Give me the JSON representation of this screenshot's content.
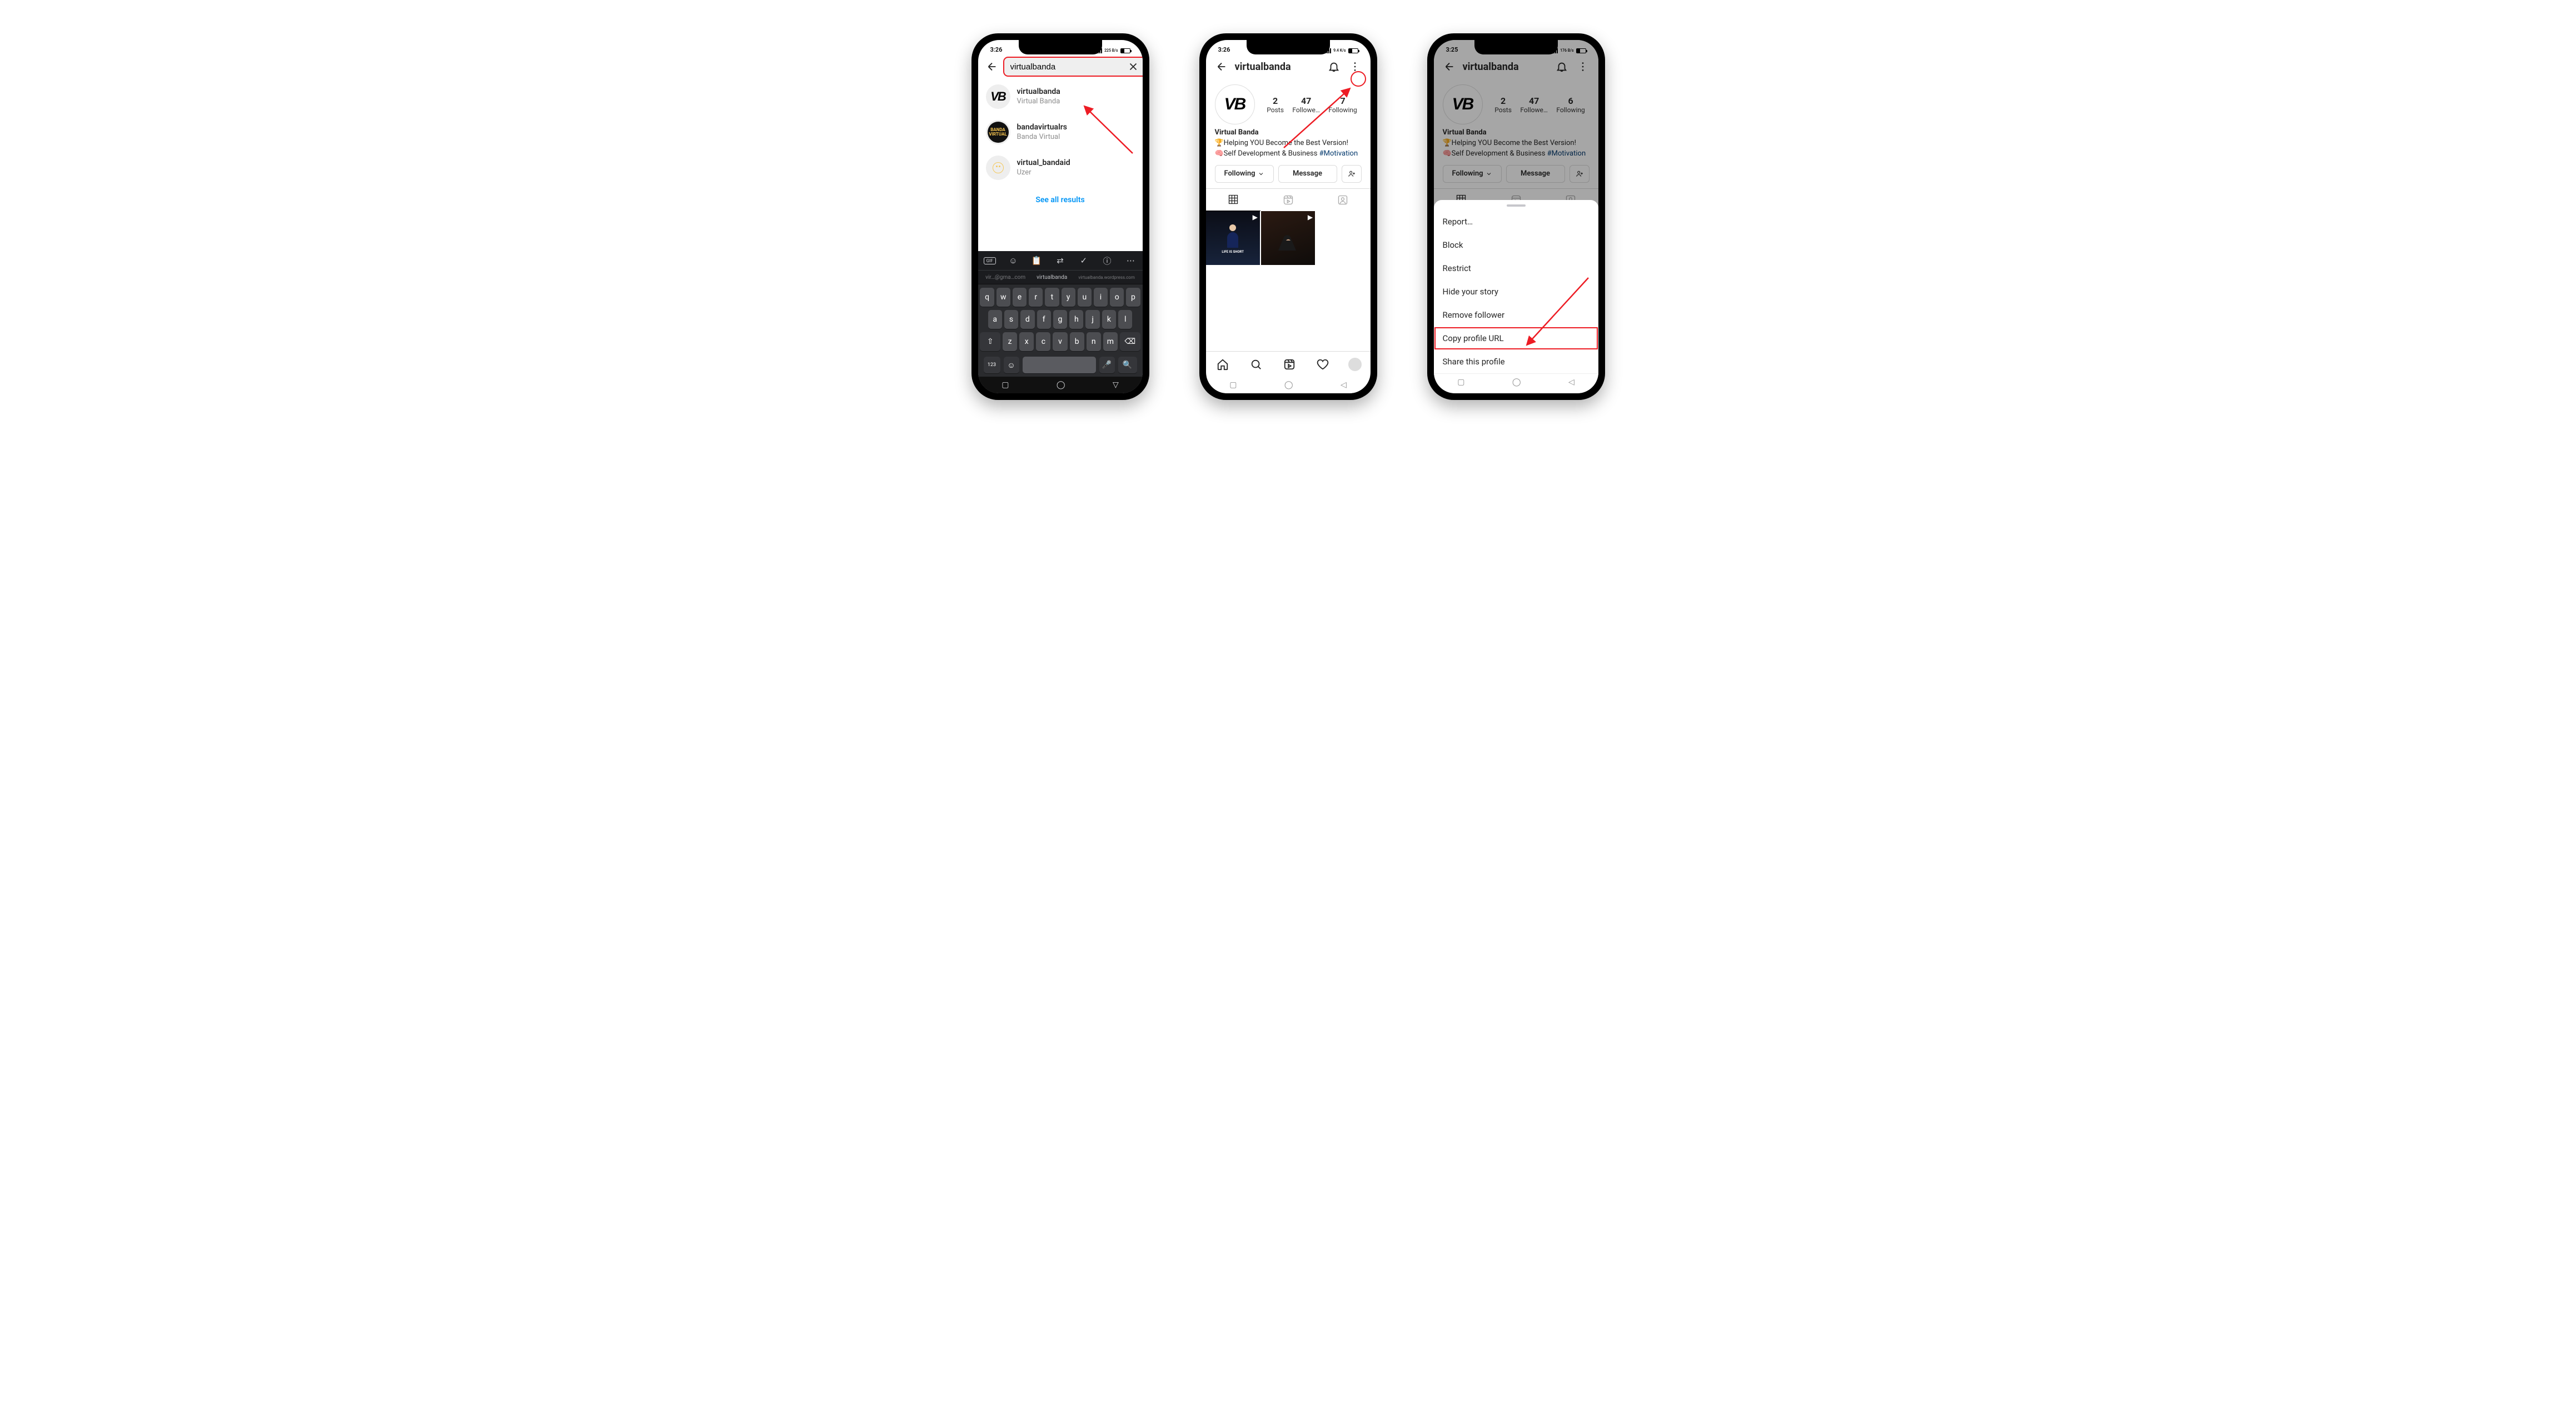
{
  "status": {
    "time1": "3:26",
    "time2": "3:26",
    "time3": "3:25",
    "speed1": "225\nB/s",
    "speed2": "9.4\nK/s",
    "speed3": "176\nB/s"
  },
  "search": {
    "value": "virtualbanda",
    "results": [
      {
        "username": "virtualbanda",
        "display": "Virtual Banda"
      },
      {
        "username": "bandavirtualrs",
        "display": "Banda Virtual"
      },
      {
        "username": "virtual_bandaid",
        "display": "Uzer"
      }
    ],
    "see_all": "See all results"
  },
  "keyboard": {
    "suggestions": {
      "dim_left": "vir…@gma…com",
      "center": "virtualbanda",
      "dim_right": "virtualbanda.wordpress.com"
    },
    "row1": [
      "q",
      "w",
      "e",
      "r",
      "t",
      "y",
      "u",
      "i",
      "o",
      "p"
    ],
    "row2": [
      "a",
      "s",
      "d",
      "f",
      "g",
      "h",
      "j",
      "k",
      "l"
    ],
    "row3": [
      "⇧",
      "z",
      "x",
      "c",
      "v",
      "b",
      "n",
      "m",
      "⌫"
    ],
    "bottom": {
      "num": "123",
      "emoji": "☺",
      "mic": "🎤",
      "search": "🔍"
    }
  },
  "profile": {
    "username": "virtualbanda",
    "posts": {
      "n": "2",
      "label": "Posts"
    },
    "followers": {
      "n": "47",
      "label": "Followe…"
    },
    "following": {
      "n": "7",
      "label": "Following"
    },
    "following3": {
      "n": "6",
      "label": "Following"
    },
    "name": "Virtual Banda",
    "bio1": "🏆Helping YOU Become the Best Version!",
    "bio2_pre": "🧠Self Development & Business ",
    "bio2_tag": "#Motivation",
    "btn_following": "Following",
    "btn_message": "Message",
    "post_caption": "LIFE IS SHORT"
  },
  "sheet": {
    "items": [
      "Report…",
      "Block",
      "Restrict",
      "Hide your story",
      "Remove follower",
      "Copy profile URL",
      "Share this profile"
    ],
    "highlight_index": 5
  }
}
